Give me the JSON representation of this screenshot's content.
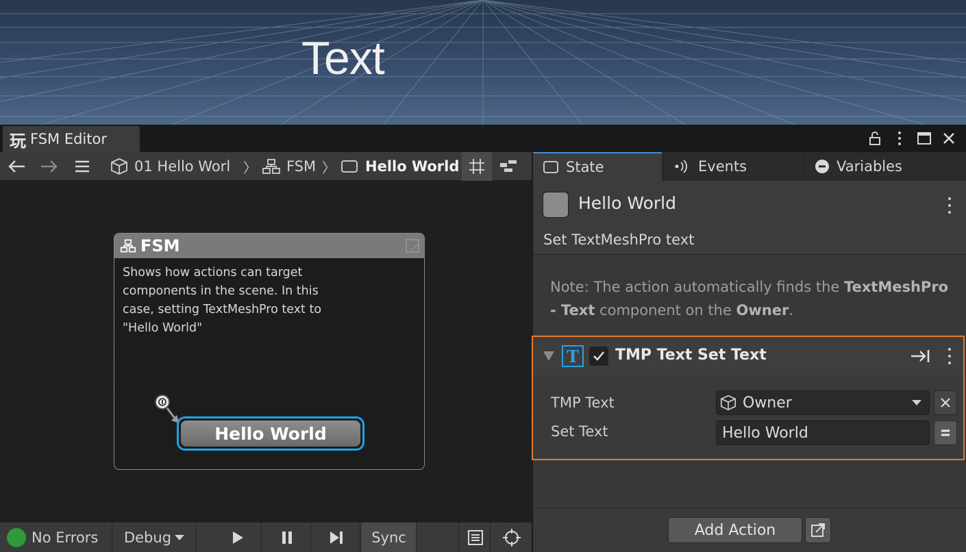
{
  "scene": {
    "label": "Text"
  },
  "window": {
    "tab_icon": "玩",
    "title": "FSM Editor",
    "buttons": [
      "lock-icon",
      "more-icon",
      "maximize-icon",
      "close-icon"
    ]
  },
  "toolbar": {
    "breadcrumbs": [
      {
        "icon": "cube-icon",
        "label": "01 Hello Worl"
      },
      {
        "icon": "hierarchy-icon",
        "label": "FSM"
      },
      {
        "icon": "state-icon",
        "label": "Hello World"
      }
    ]
  },
  "fsm": {
    "title": "FSM",
    "description": "Shows how actions can target components in the scene. In this case, setting TextMeshPro text to \"Hello World\"",
    "state_node": "Hello World"
  },
  "bottombar": {
    "status": "No Errors",
    "debug": "Debug",
    "sync": "Sync",
    "status_color": "#2e9a3b"
  },
  "inspector": {
    "tabs": [
      {
        "icon": "state-icon",
        "label": "State"
      },
      {
        "icon": "events-icon",
        "label": "Events"
      },
      {
        "icon": "variables-icon",
        "label": "Variables"
      }
    ],
    "state_name": "Hello World",
    "state_description": "Set TextMeshPro text",
    "note": {
      "prefix": "Note: The action automatically finds the ",
      "component": "TextMeshPro - Text",
      "middle": " component on the ",
      "owner": "Owner",
      "suffix": "."
    },
    "action": {
      "title": "TMP Text Set Text",
      "rows": [
        {
          "label": "TMP Text",
          "value": "Owner"
        },
        {
          "label": "Set Text",
          "value": "Hello World"
        }
      ]
    },
    "add_action": "Add Action"
  },
  "colors": {
    "accent_blue": "#1fa2ea",
    "highlight_orange": "#e6792a",
    "tmp_icon_blue": "#27a0e8"
  }
}
